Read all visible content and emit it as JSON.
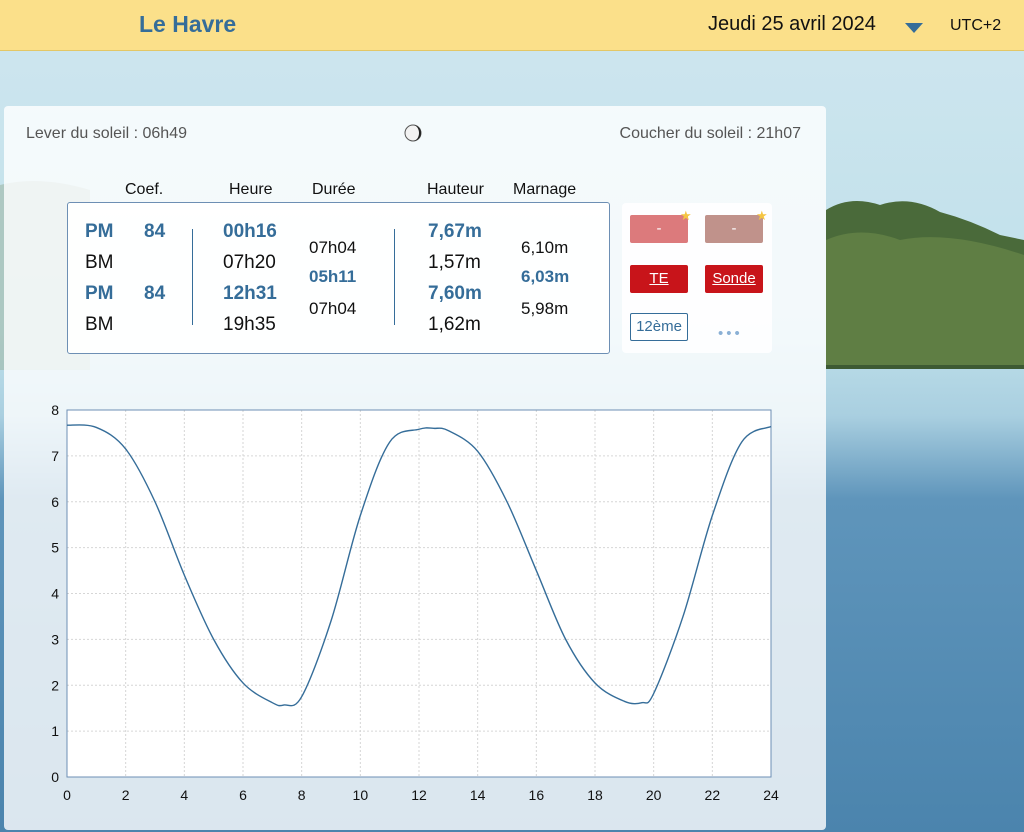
{
  "header": {
    "city": "Le Havre",
    "date": "Jeudi 25 avril 2024",
    "timezone": "UTC+2",
    "colors": {
      "bar": "#fbe08a",
      "accent": "#356d99"
    }
  },
  "sun": {
    "sunrise": "Lever du soleil : 06h49",
    "sunset": "Coucher du soleil : 21h07"
  },
  "table": {
    "headers": {
      "coef": "Coef.",
      "heure": "Heure",
      "duree": "Durée",
      "hauteur": "Hauteur",
      "marnage": "Marnage"
    },
    "rows": [
      {
        "type": "PM",
        "coef": "84",
        "heure": "00h16",
        "hauteur": "7,67m"
      },
      {
        "type": "BM",
        "coef": "",
        "heure": "07h20",
        "hauteur": "1,57m"
      },
      {
        "type": "PM",
        "coef": "84",
        "heure": "12h31",
        "hauteur": "7,60m"
      },
      {
        "type": "BM",
        "coef": "",
        "heure": "19h35",
        "hauteur": "1,62m"
      }
    ],
    "durees": [
      "07h04",
      "05h11",
      "07h04"
    ],
    "marnages": [
      "6,10m",
      "6,03m",
      "5,98m"
    ]
  },
  "tools": {
    "btn1": "-",
    "btn2": "-",
    "te": "TE",
    "sonde": "Sonde",
    "twelfth": "12ème",
    "more": "•••"
  },
  "chart_data": {
    "type": "line",
    "x_ticks": [
      "0",
      "2",
      "4",
      "6",
      "8",
      "10",
      "12",
      "14",
      "16",
      "18",
      "20",
      "22",
      "24"
    ],
    "y_ticks": [
      "0",
      "1",
      "2",
      "3",
      "4",
      "5",
      "6",
      "7",
      "8"
    ],
    "xlim": [
      0,
      24
    ],
    "ylim": [
      0,
      8
    ],
    "grid": true,
    "series": [
      {
        "color": "#356d99",
        "x": [
          0,
          1,
          2,
          3,
          4,
          5,
          6,
          7,
          7.4,
          8,
          9,
          10,
          11,
          12,
          12.5,
          13,
          14,
          15,
          16,
          17,
          18,
          19,
          19.6,
          20,
          21,
          22,
          23,
          24
        ],
        "y": [
          7.67,
          7.62,
          7.15,
          6.0,
          4.4,
          3.0,
          2.05,
          1.62,
          1.57,
          1.75,
          3.4,
          5.7,
          7.3,
          7.58,
          7.6,
          7.55,
          7.1,
          6.0,
          4.5,
          3.0,
          2.05,
          1.65,
          1.62,
          1.82,
          3.5,
          5.7,
          7.3,
          7.64
        ]
      }
    ]
  }
}
